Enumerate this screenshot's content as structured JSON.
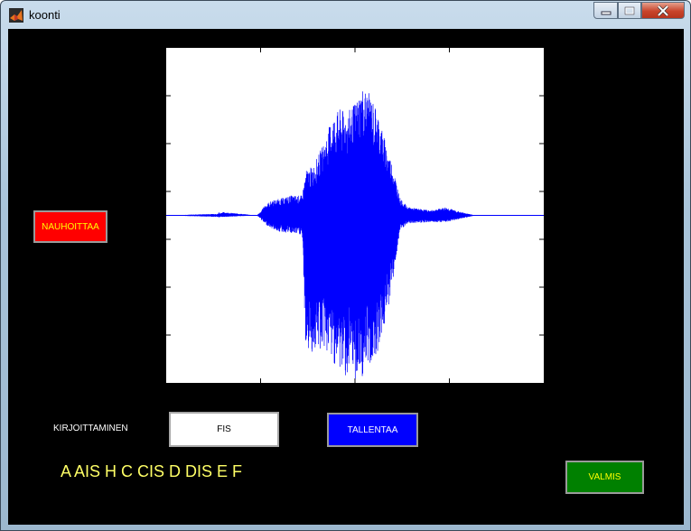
{
  "window": {
    "title": "koonti",
    "minimize_glyph": "–",
    "maximize_glyph": "□",
    "close_glyph": "✕"
  },
  "controls": {
    "record_label": "NAUHOITTAA",
    "writing_label": "KIRJOITTAMINEN",
    "note_value": "FIS",
    "save_label": "TALLENTAA",
    "notes_text": "A  AIS  H  C  CIS  D  DIS  E  F",
    "done_label": "VALMIS"
  },
  "colors": {
    "background": "#000000",
    "plot_background": "#ffffff",
    "waveform": "#0000ff",
    "record_button": "#ff0000",
    "save_button": "#0000ff",
    "done_button": "#008000",
    "notes_text": "#ffff66"
  },
  "chart_data": {
    "type": "line",
    "title": "",
    "xlabel": "",
    "ylabel": "",
    "grid": false,
    "x_ticks": 3,
    "y_ticks": 6,
    "waveform_envelope": [
      {
        "x": 0.0,
        "top": 0.0,
        "bottom": 0.0
      },
      {
        "x": 0.14,
        "top": 0.01,
        "bottom": -0.01
      },
      {
        "x": 0.15,
        "top": 0.02,
        "bottom": -0.01
      },
      {
        "x": 0.24,
        "top": 0.0,
        "bottom": 0.0
      },
      {
        "x": 0.25,
        "top": 0.02,
        "bottom": -0.02
      },
      {
        "x": 0.26,
        "top": 0.06,
        "bottom": -0.05
      },
      {
        "x": 0.28,
        "top": 0.09,
        "bottom": -0.08
      },
      {
        "x": 0.3,
        "top": 0.1,
        "bottom": -0.1
      },
      {
        "x": 0.33,
        "top": 0.12,
        "bottom": -0.11
      },
      {
        "x": 0.36,
        "top": 0.12,
        "bottom": -0.12
      },
      {
        "x": 0.37,
        "top": 0.27,
        "bottom": -0.83
      },
      {
        "x": 0.39,
        "top": 0.3,
        "bottom": -0.83
      },
      {
        "x": 0.42,
        "top": 0.45,
        "bottom": -0.81
      },
      {
        "x": 0.44,
        "top": 0.6,
        "bottom": -0.88
      },
      {
        "x": 0.46,
        "top": 0.64,
        "bottom": -0.94
      },
      {
        "x": 0.48,
        "top": 0.62,
        "bottom": -0.98
      },
      {
        "x": 0.5,
        "top": 0.68,
        "bottom": -1.0
      },
      {
        "x": 0.52,
        "top": 0.78,
        "bottom": -0.98
      },
      {
        "x": 0.54,
        "top": 0.73,
        "bottom": -0.91
      },
      {
        "x": 0.56,
        "top": 0.63,
        "bottom": -0.82
      },
      {
        "x": 0.58,
        "top": 0.45,
        "bottom": -0.66
      },
      {
        "x": 0.6,
        "top": 0.3,
        "bottom": -0.4
      },
      {
        "x": 0.62,
        "top": 0.1,
        "bottom": -0.09
      },
      {
        "x": 0.64,
        "top": 0.05,
        "bottom": -0.05
      },
      {
        "x": 0.7,
        "top": 0.03,
        "bottom": -0.04
      },
      {
        "x": 0.74,
        "top": 0.05,
        "bottom": -0.04
      },
      {
        "x": 0.78,
        "top": 0.02,
        "bottom": -0.02
      },
      {
        "x": 0.82,
        "top": 0.0,
        "bottom": 0.0
      },
      {
        "x": 1.0,
        "top": 0.0,
        "bottom": 0.0
      }
    ]
  }
}
